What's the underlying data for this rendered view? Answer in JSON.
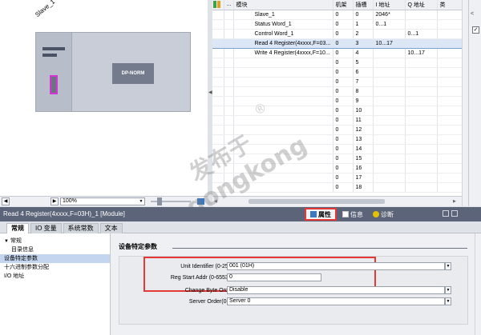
{
  "device_view": {
    "slave_label": "Slave_1",
    "module_label": "DP-NORM",
    "zoom": "100%"
  },
  "table": {
    "headers": [
      "",
      "",
      "模块",
      "机架",
      "插槽",
      "I 地址",
      "Q 地址",
      "类"
    ],
    "rows": [
      {
        "module": "Slave_1",
        "rack": "0",
        "slot": "0",
        "i_addr": "2046*",
        "q_addr": "",
        "selected": false
      },
      {
        "module": "Status Word_1",
        "rack": "0",
        "slot": "1",
        "i_addr": "0...1",
        "q_addr": "",
        "selected": false
      },
      {
        "module": "Control Word_1",
        "rack": "0",
        "slot": "2",
        "i_addr": "",
        "q_addr": "0...1",
        "selected": false
      },
      {
        "module": "Read 4 Register(4xxxx,F=03...",
        "rack": "0",
        "slot": "3",
        "i_addr": "10...17",
        "q_addr": "",
        "selected": true
      },
      {
        "module": "Write 4 Register(4xxxx,F=10...",
        "rack": "0",
        "slot": "4",
        "i_addr": "",
        "q_addr": "10...17",
        "selected": false
      },
      {
        "module": "",
        "rack": "0",
        "slot": "5",
        "i_addr": "",
        "q_addr": "",
        "selected": false
      },
      {
        "module": "",
        "rack": "0",
        "slot": "6",
        "i_addr": "",
        "q_addr": "",
        "selected": false
      },
      {
        "module": "",
        "rack": "0",
        "slot": "7",
        "i_addr": "",
        "q_addr": "",
        "selected": false
      },
      {
        "module": "",
        "rack": "0",
        "slot": "8",
        "i_addr": "",
        "q_addr": "",
        "selected": false
      },
      {
        "module": "",
        "rack": "0",
        "slot": "9",
        "i_addr": "",
        "q_addr": "",
        "selected": false
      },
      {
        "module": "",
        "rack": "0",
        "slot": "10",
        "i_addr": "",
        "q_addr": "",
        "selected": false
      },
      {
        "module": "",
        "rack": "0",
        "slot": "11",
        "i_addr": "",
        "q_addr": "",
        "selected": false
      },
      {
        "module": "",
        "rack": "0",
        "slot": "12",
        "i_addr": "",
        "q_addr": "",
        "selected": false
      },
      {
        "module": "",
        "rack": "0",
        "slot": "13",
        "i_addr": "",
        "q_addr": "",
        "selected": false
      },
      {
        "module": "",
        "rack": "0",
        "slot": "14",
        "i_addr": "",
        "q_addr": "",
        "selected": false
      },
      {
        "module": "",
        "rack": "0",
        "slot": "15",
        "i_addr": "",
        "q_addr": "",
        "selected": false
      },
      {
        "module": "",
        "rack": "0",
        "slot": "16",
        "i_addr": "",
        "q_addr": "",
        "selected": false
      },
      {
        "module": "",
        "rack": "0",
        "slot": "17",
        "i_addr": "",
        "q_addr": "",
        "selected": false
      },
      {
        "module": "",
        "rack": "0",
        "slot": "18",
        "i_addr": "",
        "q_addr": "",
        "selected": false
      }
    ]
  },
  "inspector": {
    "title": "Read 4 Register(4xxxx,F=03H)_1 [Module]",
    "tabs": [
      {
        "label": "属性",
        "icon": "properties-icon",
        "active": true
      },
      {
        "label": "信息",
        "icon": "info-icon",
        "active": false
      },
      {
        "label": "诊断",
        "icon": "diagnostics-icon",
        "active": false
      }
    ],
    "subtabs": [
      "常规",
      "IO 变量",
      "系统常数",
      "文本"
    ],
    "nav": [
      {
        "label": "常规",
        "level": 0,
        "highlight": false,
        "expander": "▼"
      },
      {
        "label": "目录信息",
        "level": 1,
        "highlight": false,
        "expander": ""
      },
      {
        "label": "设备特定参数",
        "level": 0,
        "highlight": true,
        "expander": ""
      },
      {
        "label": "十六进制参数分配",
        "level": 0,
        "highlight": false,
        "expander": ""
      },
      {
        "label": "I/O 地址",
        "level": 0,
        "highlight": false,
        "expander": ""
      }
    ],
    "section_title": "设备特定参数",
    "params": [
      {
        "label": "Unit Identifier (0-255):",
        "value": "001 (01H)",
        "dropdown": true
      },
      {
        "label": "Reg Start Addr (0-65535):",
        "value": "0",
        "dropdown": false
      },
      {
        "label": "Change Byte Order:",
        "value": "Disable",
        "dropdown": true
      },
      {
        "label": "Server Order(0-7):",
        "value": "Server 0",
        "dropdown": true
      }
    ]
  },
  "watermark": {
    "cn": "发布于",
    "en": "gongkong",
    "reg": "®"
  },
  "colors": {
    "highlight_red": "#e53935",
    "inspector_bar": "#5b6478",
    "selection_blue": "#dbe6f7",
    "module_port_magenta": "#d633d6"
  }
}
